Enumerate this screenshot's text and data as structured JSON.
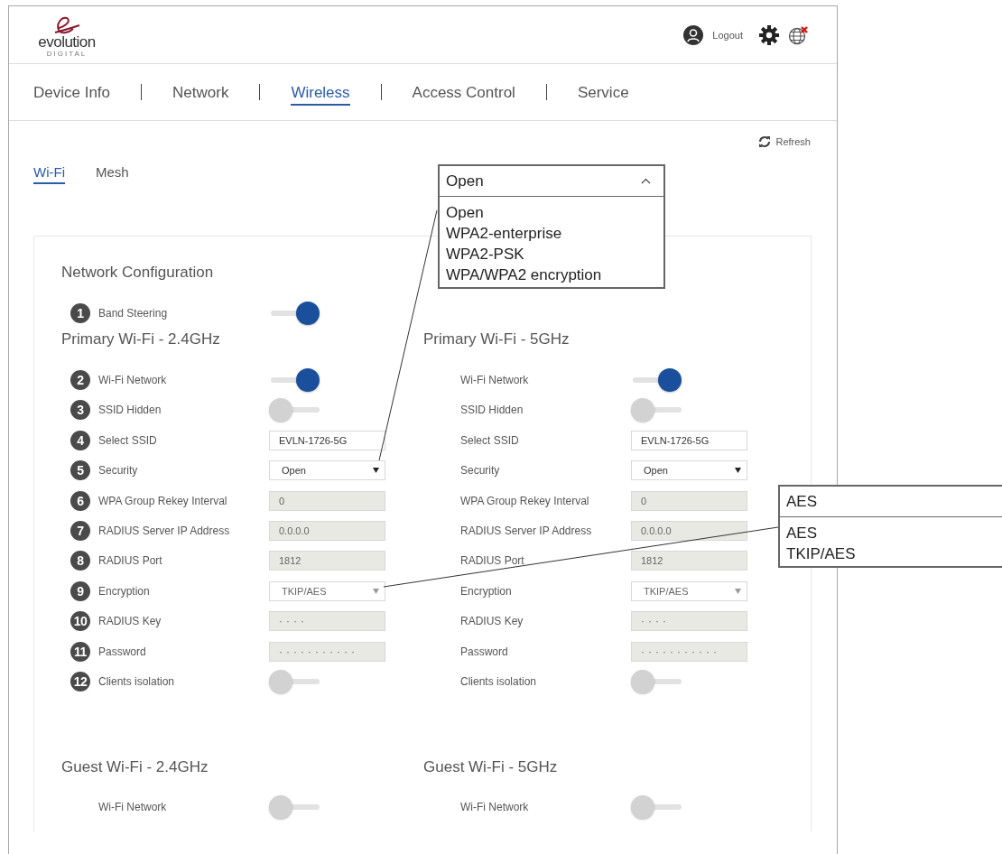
{
  "header": {
    "logo_name": "evolution",
    "logo_tagline": "DIGITAL",
    "logout": "Logout"
  },
  "nav_tabs": [
    {
      "label": "Device Info",
      "selected": false
    },
    {
      "label": "Network",
      "selected": false
    },
    {
      "label": "Wireless",
      "selected": true
    },
    {
      "label": "Access Control",
      "selected": false
    },
    {
      "label": "Service",
      "selected": false
    }
  ],
  "sub_tabs": [
    {
      "label": "Wi-Fi",
      "selected": true
    },
    {
      "label": "Mesh",
      "selected": false
    }
  ],
  "refresh": "Refresh",
  "network_configuration": {
    "title": "Network Configuration",
    "band_steering": {
      "number": "1",
      "label": "Band Steering",
      "kind": "toggle",
      "on": true
    }
  },
  "primary": [
    {
      "title": "Primary Wi-Fi - 2.4GHz",
      "rows": [
        {
          "number": "2",
          "label": "Wi-Fi Network",
          "kind": "toggle",
          "on": true
        },
        {
          "number": "3",
          "label": "SSID Hidden",
          "kind": "toggle",
          "on": false
        },
        {
          "number": "4",
          "label": "Select SSID",
          "kind": "field",
          "value": "EVLN-1726-5G",
          "disabled": false
        },
        {
          "number": "5",
          "label": "Security",
          "kind": "select",
          "value": "Open",
          "disabled": false
        },
        {
          "number": "6",
          "label": "WPA Group Rekey Interval",
          "kind": "field",
          "value": "0",
          "disabled": true
        },
        {
          "number": "7",
          "label": "RADIUS Server IP Address",
          "kind": "field",
          "value": "0.0.0.0",
          "disabled": true
        },
        {
          "number": "8",
          "label": "RADIUS Port",
          "kind": "field",
          "value": "1812",
          "disabled": true
        },
        {
          "number": "9",
          "label": "Encryption",
          "kind": "select",
          "value": "TKIP/AES",
          "disabled": true
        },
        {
          "number": "10",
          "label": "RADIUS Key",
          "kind": "field",
          "value": "····",
          "disabled": true
        },
        {
          "number": "11",
          "label": "Password",
          "kind": "field",
          "value": "···········",
          "disabled": true
        },
        {
          "number": "12",
          "label": "Clients isolation",
          "kind": "toggle",
          "on": false
        }
      ]
    },
    {
      "title": "Primary Wi-Fi - 5GHz",
      "rows": [
        {
          "label": "Wi-Fi Network",
          "kind": "toggle",
          "on": true
        },
        {
          "label": "SSID Hidden",
          "kind": "toggle",
          "on": false
        },
        {
          "label": "Select SSID",
          "kind": "field",
          "value": "EVLN-1726-5G",
          "disabled": false
        },
        {
          "label": "Security",
          "kind": "select",
          "value": "Open",
          "disabled": false
        },
        {
          "label": "WPA Group Rekey Interval",
          "kind": "field",
          "value": "0",
          "disabled": true
        },
        {
          "label": "RADIUS Server IP Address",
          "kind": "field",
          "value": "0.0.0.0",
          "disabled": true
        },
        {
          "label": "RADIUS Port",
          "kind": "field",
          "value": "1812",
          "disabled": true
        },
        {
          "label": "Encryption",
          "kind": "select",
          "value": "TKIP/AES",
          "disabled": true
        },
        {
          "label": "RADIUS Key",
          "kind": "field",
          "value": "····",
          "disabled": true
        },
        {
          "label": "Password",
          "kind": "field",
          "value": "···········",
          "disabled": true
        },
        {
          "label": "Clients isolation",
          "kind": "toggle",
          "on": false
        }
      ]
    }
  ],
  "guest": [
    {
      "title": "Guest Wi-Fi - 2.4GHz",
      "rows": [
        {
          "label": "Wi-Fi Network",
          "kind": "toggle",
          "on": false
        }
      ]
    },
    {
      "title": "Guest Wi-Fi - 5GHz",
      "rows": [
        {
          "label": "Wi-Fi Network",
          "kind": "toggle",
          "on": false
        }
      ]
    }
  ],
  "callouts": [
    {
      "selected": "Open",
      "caret": true,
      "options": [
        "Open",
        "WPA2-enterprise",
        "WPA2-PSK",
        "WPA/WPA2 encryption"
      ]
    },
    {
      "selected": "AES",
      "caret": false,
      "options": [
        "AES",
        "TKIP/AES"
      ]
    }
  ]
}
